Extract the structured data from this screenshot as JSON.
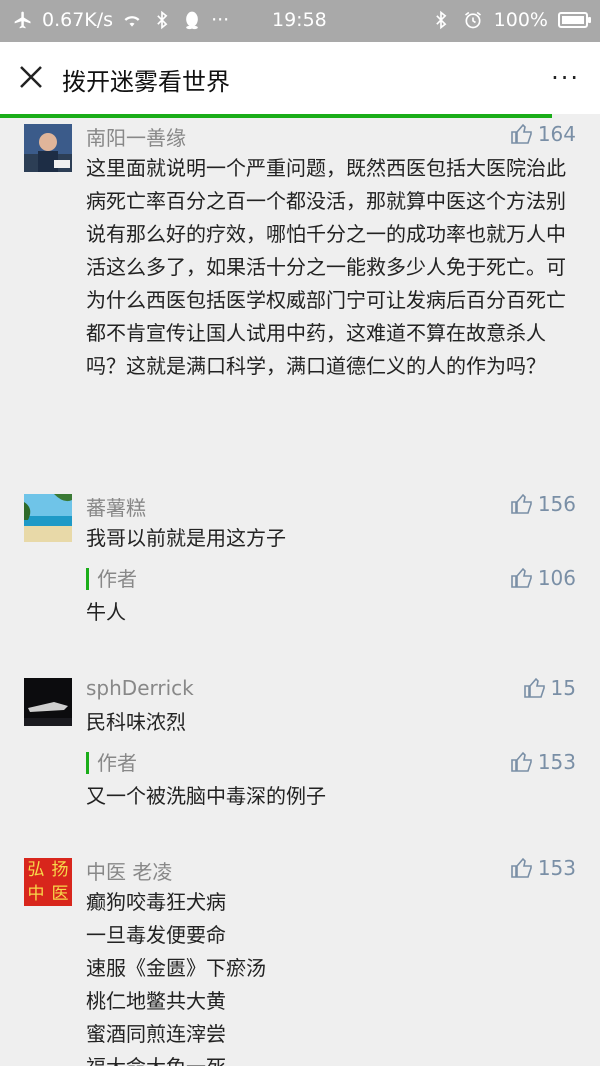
{
  "status": {
    "speed": "0.67K/s",
    "time": "19:58",
    "battery": "100%",
    "battery_level": 1.0
  },
  "header": {
    "title": "拨开迷雾看世界",
    "more": "···"
  },
  "page_progress": 0.92,
  "comments": [
    {
      "name": "南阳一善缘",
      "likes": "164",
      "text": "这里面就说明一个严重问题，既然西医包括大医院治此病死亡率百分之百一个都没活，那就算中医这个方法别说有那么好的疗效，哪怕千分之一的成功率也就万人中活这么多了，如果活十分之一能救多少人免于死亡。可为什么西医包括医学权威部门宁可让发病后百分百死亡都不肯宣传让国人试用中药，这难道不算在故意杀人吗？这就是满口科学，满口道德仁义的人的作为吗？"
    },
    {
      "name": "蕃薯糕",
      "likes": "156",
      "text": "我哥以前就是用这方子",
      "reply": {
        "label": "作者",
        "likes": "106",
        "text": "牛人"
      }
    },
    {
      "name": "sphDerrick",
      "likes": "15",
      "text": "民科味浓烈",
      "reply": {
        "label": "作者",
        "likes": "153",
        "text": "又一个被洗脑中毒深的例子"
      }
    },
    {
      "name": "中医 老凌",
      "likes": "153",
      "avatar_text": [
        "弘",
        "扬",
        "中",
        "医"
      ],
      "text": "癫狗咬毒狂犬病\n一旦毒发便要命\n速服《金匮》下瘀汤\n 桃仁地鳖共大黄\n蜜酒同煎连滓尝\n福大命大免一死"
    }
  ],
  "colors": {
    "accent_green": "#1aad19",
    "like_blue": "#7a8fa6",
    "status_bar": "#a9a9a9"
  }
}
